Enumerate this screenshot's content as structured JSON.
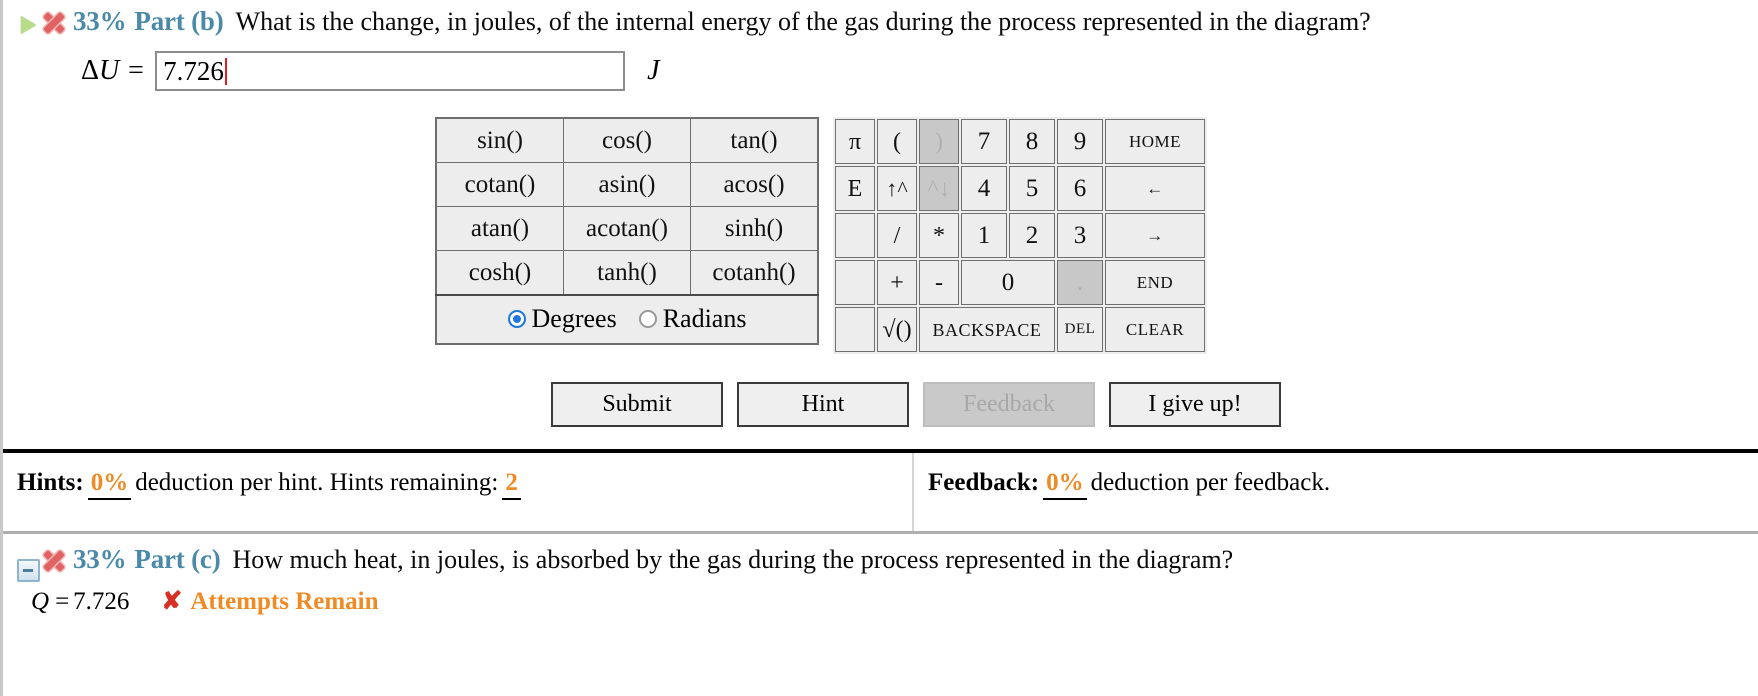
{
  "part_b": {
    "expand_icon": "green-triangle-expand-icon",
    "status_icon": "red-x-incorrect-icon",
    "percent": "33%",
    "label": "Part (b)",
    "question": "What is the change, in joules, of the internal energy of the gas during the process represented in the diagram?",
    "answer_symbol_delta": "Δ",
    "answer_symbol_var": "U",
    "answer_equals": "=",
    "answer_value": "7.726",
    "answer_placeholder": "",
    "answer_unit": "J"
  },
  "calculator": {
    "function_keys": [
      [
        "sin()",
        "cos()",
        "tan()"
      ],
      [
        "cotan()",
        "asin()",
        "acos()"
      ],
      [
        "atan()",
        "acotan()",
        "sinh()"
      ],
      [
        "cosh()",
        "tanh()",
        "cotanh()"
      ]
    ],
    "angle_mode": {
      "degrees_label": "Degrees",
      "radians_label": "Radians",
      "selected": "Degrees"
    },
    "pad": {
      "pi": "π",
      "e": "E",
      "open_paren": "(",
      "close_paren": ")",
      "power_up": "↑^",
      "power_down": "^↓",
      "divide": "/",
      "multiply": "*",
      "plus": "+",
      "minus": "-",
      "sqrt": "√()",
      "blank": ""
    },
    "digits": {
      "d7": "7",
      "d8": "8",
      "d9": "9",
      "d4": "4",
      "d5": "5",
      "d6": "6",
      "d1": "1",
      "d2": "2",
      "d3": "3",
      "d0": "0",
      "dot": "."
    },
    "nav": {
      "home": "HOME",
      "left": "←",
      "right": "→",
      "end": "END",
      "backspace": "BACKSPACE",
      "del": "DEL",
      "clear": "CLEAR"
    },
    "disabled_keys": [
      "close_paren",
      "power_down",
      "dot"
    ]
  },
  "actions": {
    "submit": "Submit",
    "hint": "Hint",
    "feedback": "Feedback",
    "give_up": "I give up!",
    "feedback_disabled": true
  },
  "status_bar": {
    "hints_label": "Hints:",
    "hints_deduction": "0%",
    "hints_text_mid": "deduction per hint. Hints remaining:",
    "hints_remaining": "2",
    "feedback_label": "Feedback:",
    "feedback_deduction": "0%",
    "feedback_text_mid": "deduction per feedback.",
    "value_color": "#f08a24"
  },
  "part_c": {
    "collapse_icon": "blue-collapse-box-icon",
    "status_icon": "red-x-incorrect-icon",
    "percent": "33%",
    "label": "Part (c)",
    "question": "How much heat, in joules, is absorbed by the gas during the process represented in the diagram?",
    "result_var": "Q",
    "result_equals": "=",
    "result_value": "7.726",
    "attempts_x": "✘",
    "attempts_text": "Attempts Remain"
  }
}
